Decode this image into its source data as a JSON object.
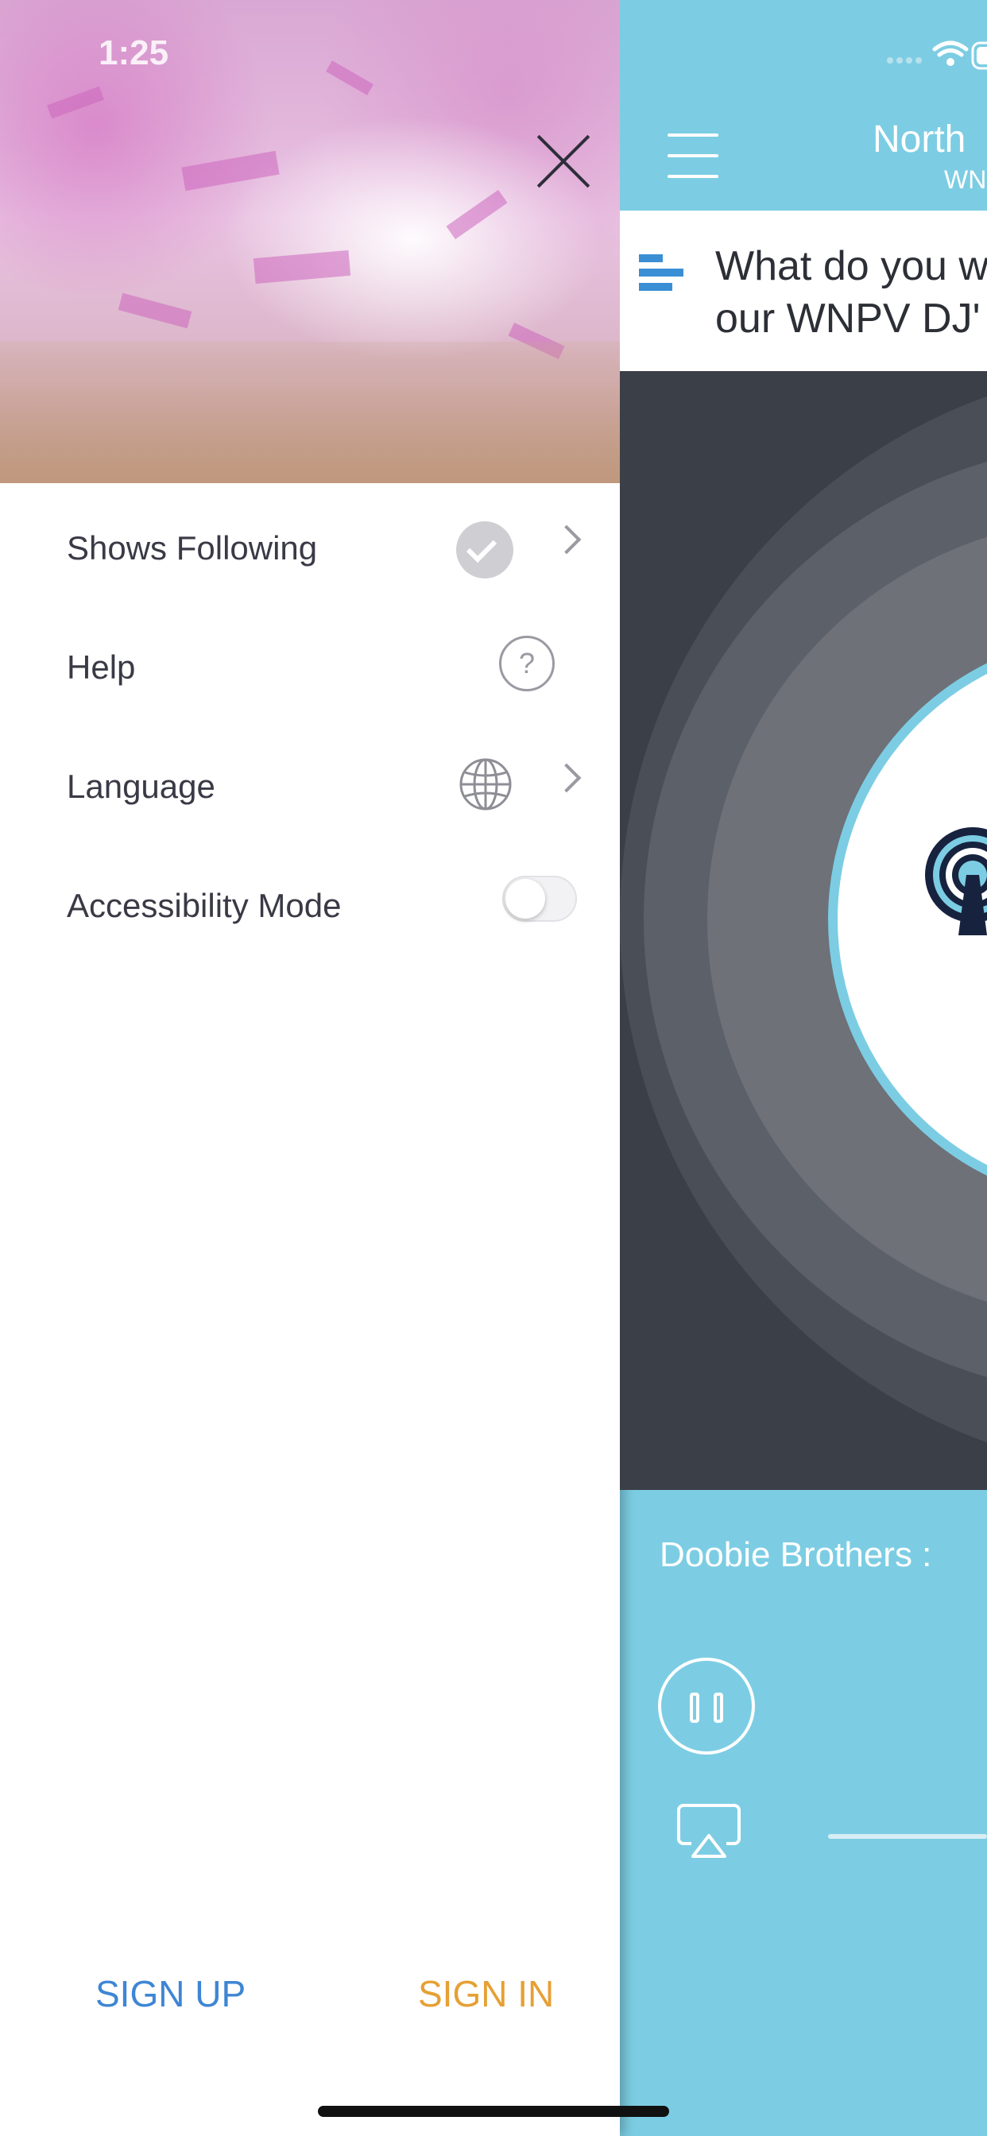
{
  "status_bar": {
    "time": "1:25"
  },
  "drawer": {
    "menu": [
      {
        "label": "Shows Following",
        "icon": "check-circle-icon",
        "has_chevron": true
      },
      {
        "label": "Help",
        "icon": "help-circle-icon",
        "has_chevron": false
      },
      {
        "label": "Language",
        "icon": "globe-icon",
        "has_chevron": true
      },
      {
        "label": "Accessibility Mode",
        "toggle_on": false
      }
    ],
    "sign_up_label": "SIGN UP",
    "sign_in_label": "SIGN IN"
  },
  "background_app": {
    "title": "North",
    "subtitle": "WN",
    "news_line1": "What do you w",
    "news_line2": "our WNPV DJ'",
    "now_playing": "Doobie Brothers : "
  },
  "colors": {
    "app_bg": "#7ccde3",
    "sign_up": "#3e86d4",
    "sign_in": "#e6a034",
    "player_dark": "#3b3f47"
  }
}
